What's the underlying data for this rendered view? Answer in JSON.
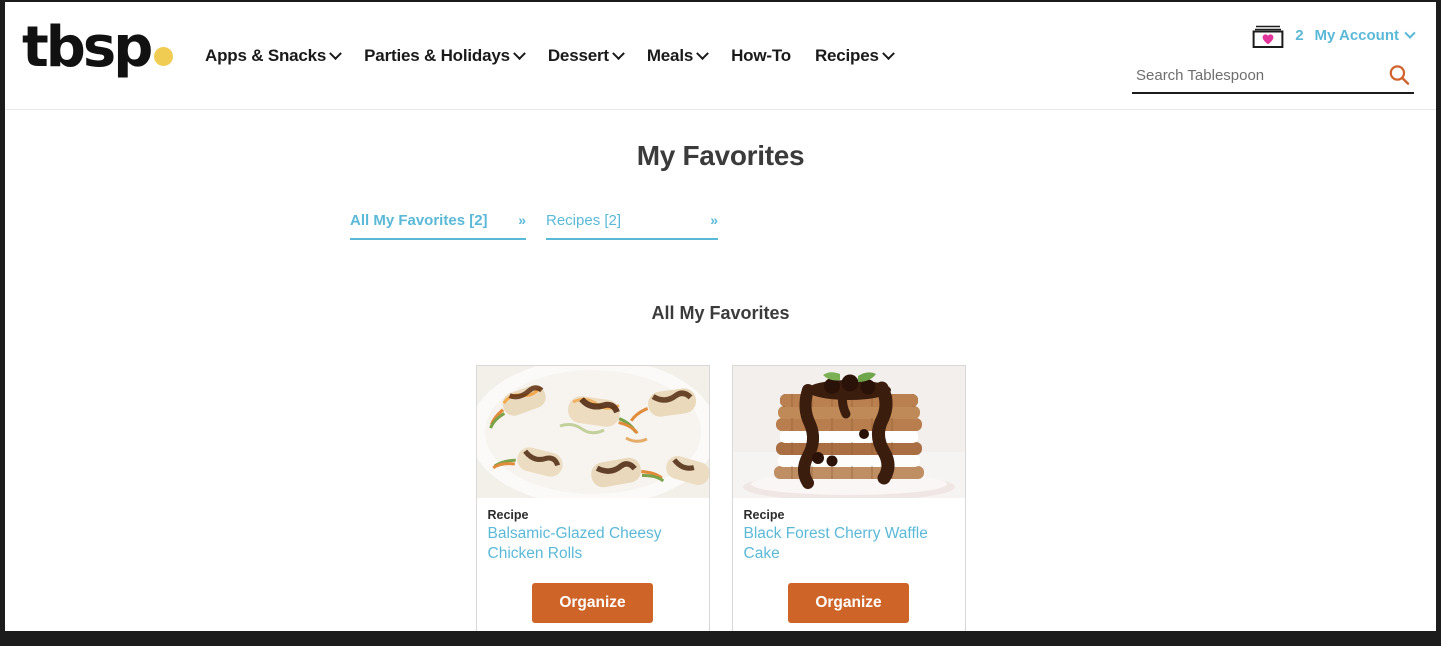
{
  "header": {
    "logo_text": "tbsp",
    "logo_dot_color": "#f0cc52",
    "nav": [
      {
        "label": "Apps & Snacks",
        "has_chevron": true,
        "icon": "chevron-down-icon"
      },
      {
        "label": "Parties & Holidays",
        "has_chevron": true,
        "icon": "chevron-down-icon"
      },
      {
        "label": "Dessert",
        "has_chevron": true,
        "icon": "chevron-down-icon"
      },
      {
        "label": "Meals",
        "has_chevron": true,
        "icon": "chevron-down-icon"
      },
      {
        "label": "How-To",
        "has_chevron": false,
        "icon": ""
      },
      {
        "label": "Recipes",
        "has_chevron": true,
        "icon": "chevron-down-icon"
      }
    ],
    "account": {
      "recipe_box_icon": "recipe-box-heart-icon",
      "heart_color": "#e2349b",
      "favorites_count": "2",
      "my_account_label": "My Account",
      "accent_color": "#5bb9d8"
    },
    "search": {
      "placeholder": "Search Tablespoon",
      "value": "",
      "icon": "search-icon",
      "icon_color": "#d2622b"
    }
  },
  "main": {
    "page_title": "My Favorites",
    "tabs": [
      {
        "label": "All My Favorites [2]",
        "chevs": "»",
        "active": true
      },
      {
        "label": "Recipes [2]",
        "chevs": "»",
        "active": false
      }
    ],
    "section_title": "All My Favorites",
    "cards": [
      {
        "kicker": "Recipe",
        "title": "Balsamic-Glazed Cheesy Chicken Rolls",
        "button_label": "Organize",
        "image_alt": "balsamic glazed chicken rolls on a white plate"
      },
      {
        "kicker": "Recipe",
        "title": "Black Forest Cherry Waffle Cake",
        "button_label": "Organize",
        "image_alt": "chocolate waffle cake stack with whipped cream and cherries"
      }
    ],
    "button_color": "#cf6428",
    "link_color": "#5bb9d8"
  }
}
